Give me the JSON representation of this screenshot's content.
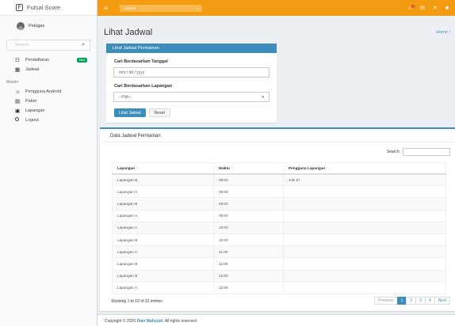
{
  "app": {
    "title": "Futsal Score",
    "logo_letter": "F"
  },
  "user": {
    "name": "Petugas"
  },
  "sidebar": {
    "search_placeholder": "Search",
    "items": [
      {
        "label": "Pendaftaran",
        "badge": "New",
        "icon": "th-icon"
      },
      {
        "label": "Jadwal",
        "icon": "calendar-icon"
      }
    ],
    "header": "Master",
    "master_items": [
      {
        "label": "Pengguna Android",
        "icon": "user-icon"
      },
      {
        "label": "Paket",
        "icon": "package-icon"
      },
      {
        "label": "Lapangan",
        "icon": "image-icon"
      },
      {
        "label": "Logout",
        "icon": "power-icon"
      }
    ]
  },
  "navbar": {
    "search_placeholder": "Search"
  },
  "page": {
    "title": "Lihat Jadwal",
    "breadcrumb": "Home",
    "breadcrumb_sep": "/"
  },
  "filter": {
    "header": "Lihat Jadwal Permainan",
    "date_label": "Cari Berdasarkan Tanggal",
    "date_placeholder": "mm / dd / yyyy",
    "field_label": "Cari Berdasarkan Lapangan",
    "field_value": "--Pilih--",
    "btn_view": "Lihat Jadwal",
    "btn_reset": "Reset"
  },
  "table": {
    "title": "Data Jadwal Permainan",
    "search_label": "Search:",
    "columns": [
      "Lapangan",
      "Waktu",
      "Pengguna Lapangan"
    ],
    "rows": [
      [
        "Lapangan B",
        "08:00",
        "Joki El"
      ],
      [
        "Lapangan A",
        "08:00",
        ""
      ],
      [
        "Lapangan B",
        "09:00",
        ""
      ],
      [
        "Lapangan A",
        "09:00",
        ""
      ],
      [
        "Lapangan A",
        "10:00",
        ""
      ],
      [
        "Lapangan B",
        "10:00",
        ""
      ],
      [
        "Lapangan A",
        "11:00",
        ""
      ],
      [
        "Lapangan B",
        "11:00",
        ""
      ],
      [
        "Lapangan B",
        "12:00",
        ""
      ],
      [
        "Lapangan A",
        "12:00",
        ""
      ]
    ],
    "info": "Showing 1 to 10 of 32 entries",
    "pager": {
      "prev": "Previous",
      "pages": [
        "1",
        "2",
        "3",
        "4"
      ],
      "next": "Next",
      "active": "1"
    }
  },
  "footer": {
    "prefix": "Copyright © 2020",
    "author": "Dian Wahyudi.",
    "suffix": "All rights reserved."
  },
  "colors": {
    "navbar": "#f39c12",
    "primary": "#3c8dbc",
    "badge": "#00a65a"
  }
}
